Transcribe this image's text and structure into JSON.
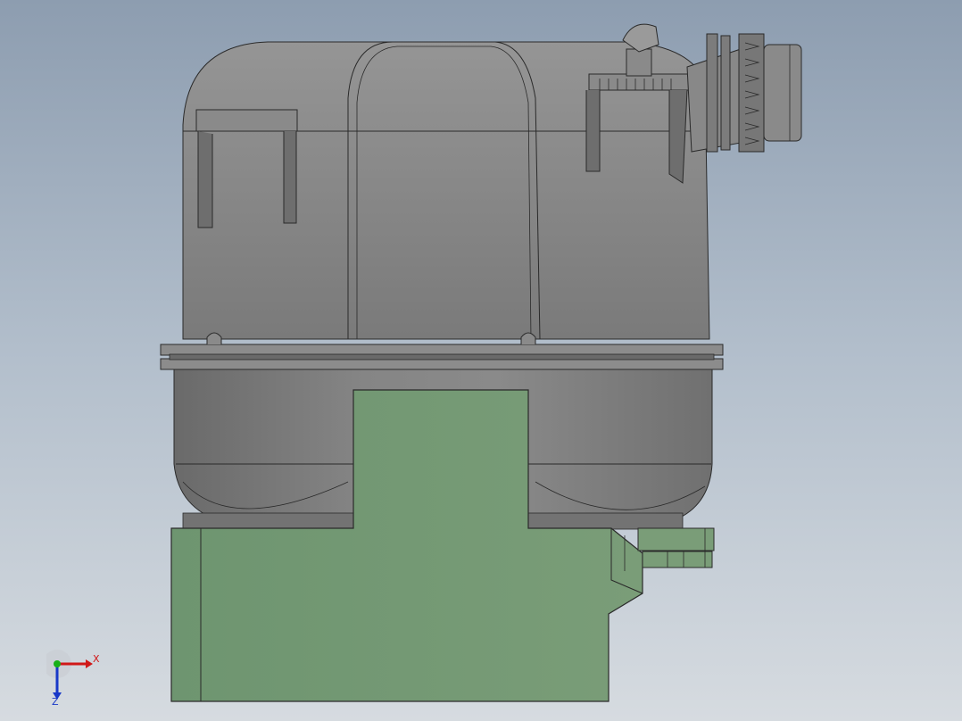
{
  "viewport": {
    "background_top": "#8d9db0",
    "background_bottom": "#d6dbe0"
  },
  "model": {
    "tank_color": "#7d7d7d",
    "bracket_color": "#7a9d78",
    "edge_color": "#2a2a2a"
  },
  "triad": {
    "x_label": "X",
    "z_label": "Z",
    "x_color": "#d01818",
    "y_color": "#18b018",
    "z_color": "#1838c8"
  }
}
